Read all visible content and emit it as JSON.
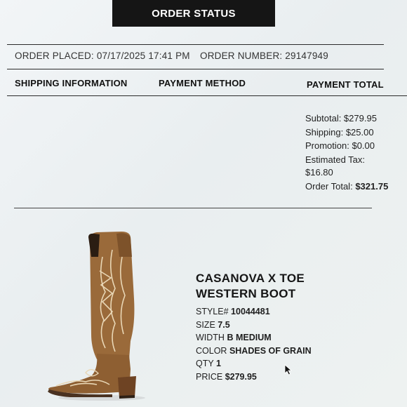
{
  "header": {
    "title": "ORDER STATUS"
  },
  "order": {
    "placed_label": "ORDER PLACED: 07/17/2025 17:41 PM",
    "number_label": "ORDER NUMBER: 29147949"
  },
  "columns": {
    "shipping": "SHIPPING INFORMATION",
    "payment_method": "PAYMENT METHOD",
    "payment_total": "PAYMENT TOTAL"
  },
  "totals": {
    "subtotal": "Subtotal: $279.95",
    "shipping": "Shipping: $25.00",
    "promotion": "Promotion: $0.00",
    "tax_label": "Estimated Tax:",
    "tax_value": "$16.80",
    "order_total_label": "Order Total:",
    "order_total_value": "$321.75"
  },
  "product": {
    "name_line1": "CASANOVA X TOE",
    "name_line2": "WESTERN BOOT",
    "image_icon": "western-boot-image",
    "attributes": [
      {
        "label": "STYLE#",
        "value": "10044481"
      },
      {
        "label": "SIZE",
        "value": "7.5"
      },
      {
        "label": "WIDTH",
        "value": "B MEDIUM"
      },
      {
        "label": "COLOR",
        "value": "SHADES OF GRAIN"
      },
      {
        "label": "QTY",
        "value": "1"
      },
      {
        "label": "PRICE",
        "value": "$279.95"
      }
    ]
  },
  "colors": {
    "header_bg": "#151515",
    "boot_leather": "#9a6a3a",
    "boot_stitch": "#e9d7b6"
  }
}
